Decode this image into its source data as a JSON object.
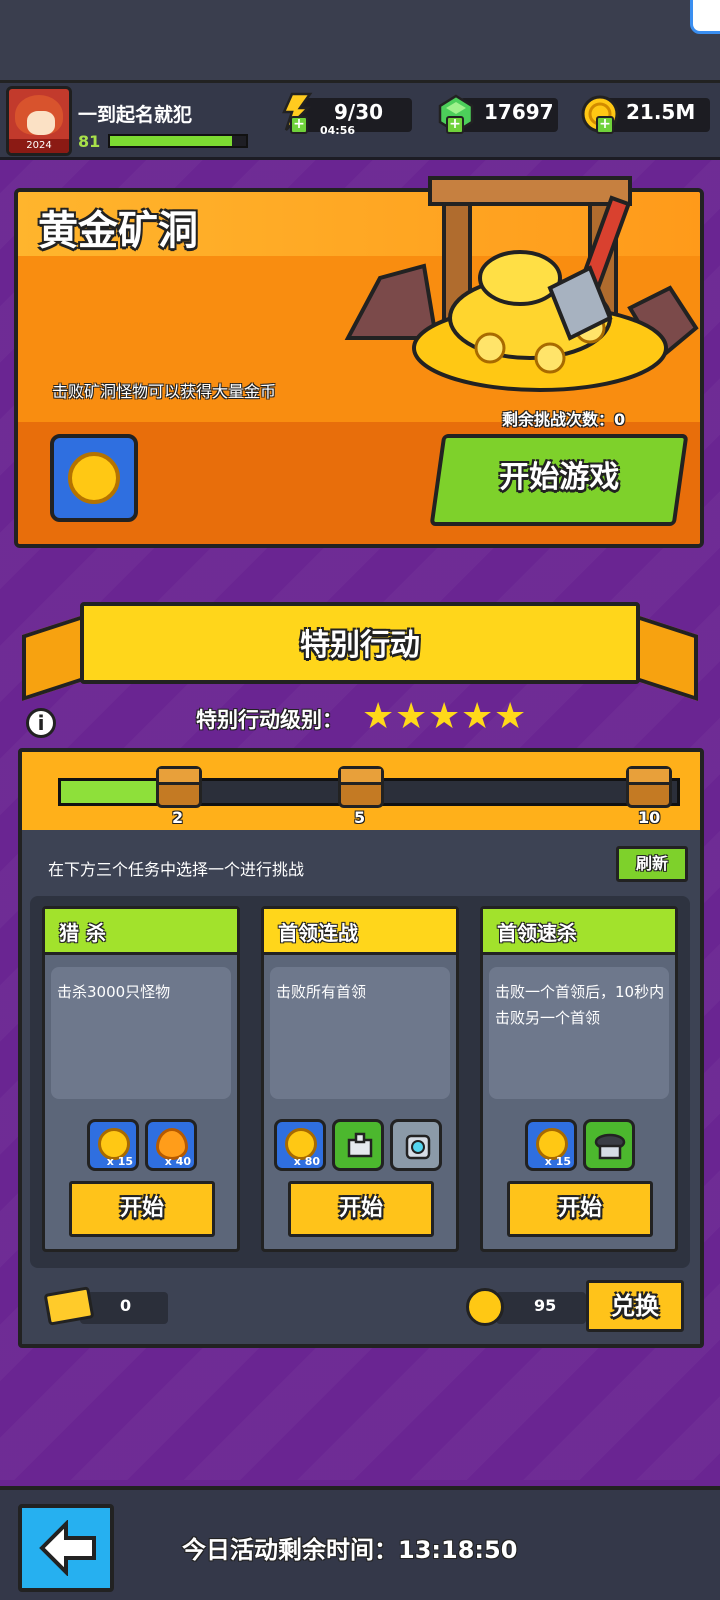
{
  "hud": {
    "player_name": "一到起名就犯",
    "level": "81",
    "avatar_year": "2024",
    "xp_progress": 0.9,
    "energy": "9/30",
    "energy_timer": "04:56",
    "gems": "17697",
    "coins": "21.5M"
  },
  "mine": {
    "title": "黄金矿洞",
    "description": "击败矿洞怪物可以获得大量金币",
    "remaining_label": "剩余挑战次数：0",
    "start_label": "开始游戏"
  },
  "special": {
    "title": "特别行动",
    "level_label": "特别行动级别：",
    "stars": 5,
    "progress": {
      "value": 2,
      "max": 10,
      "milestones": [
        "2",
        "5",
        "10"
      ]
    },
    "choose_text": "在下方三个任务中选择一个进行挑战",
    "refresh_label": "刷新",
    "tasks": [
      {
        "title": "猎 杀",
        "desc": "击杀3000只怪物",
        "rewards": [
          "x 15",
          "x 40"
        ],
        "start_label": "开始"
      },
      {
        "title": "首领连战",
        "desc": "击败所有首领",
        "rewards": [
          "x 80"
        ],
        "start_label": "开始"
      },
      {
        "title": "首领速杀",
        "desc": "击败一个首领后，10秒内击败另一个首领",
        "rewards": [
          "x 15"
        ],
        "start_label": "开始"
      }
    ],
    "tickets": "0",
    "tokens": "95",
    "exchange_label": "兑换"
  },
  "footer": {
    "remaining_time": "今日活动剩余时间：13:18:50"
  },
  "colors": {
    "background": "#6a2592",
    "mine_orange": "#f98d10",
    "green_button": "#7ed12b",
    "yellow_button": "#ffc31a",
    "hud": "#343849"
  },
  "icons": {
    "energy": "lightning-icon",
    "gem": "gem-icon",
    "coin": "coin-icon",
    "info": "info-icon",
    "back": "back-arrow-icon",
    "chest": "chest-icon",
    "ticket": "ticket-icon"
  }
}
